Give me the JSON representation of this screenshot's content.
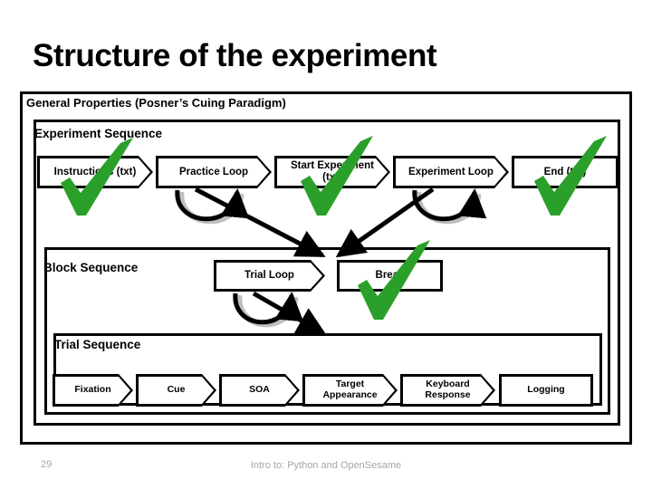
{
  "slide": {
    "title": "Structure of the experiment",
    "footer_number": "29",
    "footer_text": "Intro to: Python and OpenSesame",
    "colors": {
      "outline": "#000000",
      "check_green": "#2aa02a",
      "footer_gray": "#a6a6a6",
      "background": "#ffffff"
    }
  },
  "groups": {
    "general": {
      "label": "General Properties (Posner’s Cuing Paradigm)"
    },
    "experiment": {
      "label": "Experiment Sequence"
    },
    "block": {
      "label": "Block Sequence"
    },
    "trial": {
      "label": "Trial Sequence"
    }
  },
  "experiment_sequence": {
    "steps": [
      {
        "label": "Instructions (txt)",
        "shape": "arrow",
        "checked": true
      },
      {
        "label": "Practice Loop",
        "shape": "arrow",
        "checked": false
      },
      {
        "label": "Start Experiment (txt)",
        "shape": "arrow",
        "checked": true
      },
      {
        "label": "Experiment Loop",
        "shape": "arrow",
        "checked": false
      },
      {
        "label": "End (txt)",
        "shape": "rect",
        "checked": true
      }
    ]
  },
  "block_sequence": {
    "steps": [
      {
        "label": "Trial Loop",
        "shape": "arrow",
        "checked": false
      },
      {
        "label": "Break",
        "shape": "rect",
        "checked": true
      }
    ]
  },
  "trial_sequence": {
    "steps": [
      {
        "label": "Fixation",
        "shape": "arrow",
        "checked": false
      },
      {
        "label": "Cue",
        "shape": "arrow",
        "checked": false
      },
      {
        "label": "SOA",
        "shape": "arrow",
        "checked": false
      },
      {
        "label": "Target Appearance",
        "shape": "arrow",
        "checked": false
      },
      {
        "label": "Keyboard Response",
        "shape": "arrow",
        "checked": false
      },
      {
        "label": "Logging",
        "shape": "rect",
        "checked": false
      }
    ]
  }
}
